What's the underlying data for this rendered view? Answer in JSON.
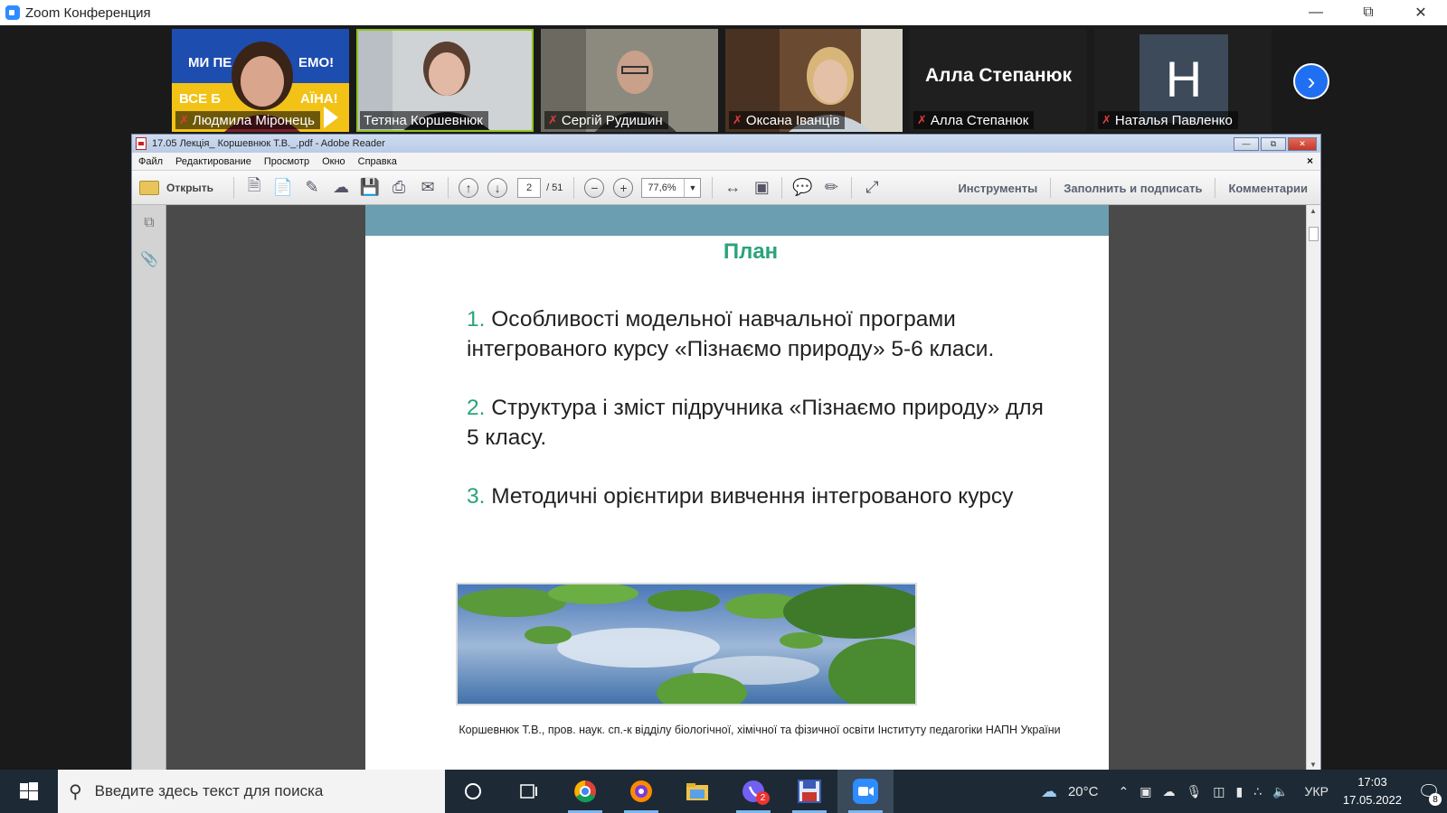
{
  "zoom": {
    "title": "Zoom Конференция",
    "participants": [
      {
        "name": "Людмила Міронець",
        "muted": true,
        "banner_top": "МИ ПЕ...ЕМО!",
        "banner_bottom": "ВСЕ Б...АЇНА!"
      },
      {
        "name": "Тетяна Коршевнюк",
        "muted": false,
        "active": true
      },
      {
        "name": "Сергій Рудишин",
        "muted": true
      },
      {
        "name": "Оксана Іванців",
        "muted": true
      },
      {
        "name": "Алла Степанюк",
        "muted": true,
        "display_name": "Алла Степанюк"
      },
      {
        "name": "Наталья Павленко",
        "muted": true,
        "avatar_letter": "Н"
      }
    ]
  },
  "reader": {
    "title": "17.05 Лекція_ Коршевнюк Т.В._.pdf - Adobe Reader",
    "menu": [
      "Файл",
      "Редактирование",
      "Просмотр",
      "Окно",
      "Справка"
    ],
    "open_label": "Открыть",
    "page_current": "2",
    "page_total": "/ 51",
    "zoom_value": "77,6%",
    "right_tools": [
      "Инструменты",
      "Заполнить и подписать",
      "Комментарии"
    ]
  },
  "slide": {
    "title": "План",
    "items": [
      {
        "num": "1.",
        "text": " Особливості модельної навчальної програми інтегрованого курсу «Пізнаємо природу» 5-6 класи."
      },
      {
        "num": "2.",
        "text": " Структура і зміст підручника «Пізнаємо природу» для 5 класу."
      },
      {
        "num": "3.",
        "text": " Методичні орієнтири вивчення інтегрованого курсу"
      }
    ],
    "footer": "Коршевнюк Т.В., пров. наук. сп.-к відділу біологічної, хімічної та фізичної освіти Інституту педагогіки НАПН України"
  },
  "taskbar": {
    "search_placeholder": "Введите здесь текст для поиска",
    "weather": "20°C",
    "language": "УКР",
    "time": "17:03",
    "date": "17.05.2022",
    "viber_badge": "2",
    "notif_count": "8"
  }
}
